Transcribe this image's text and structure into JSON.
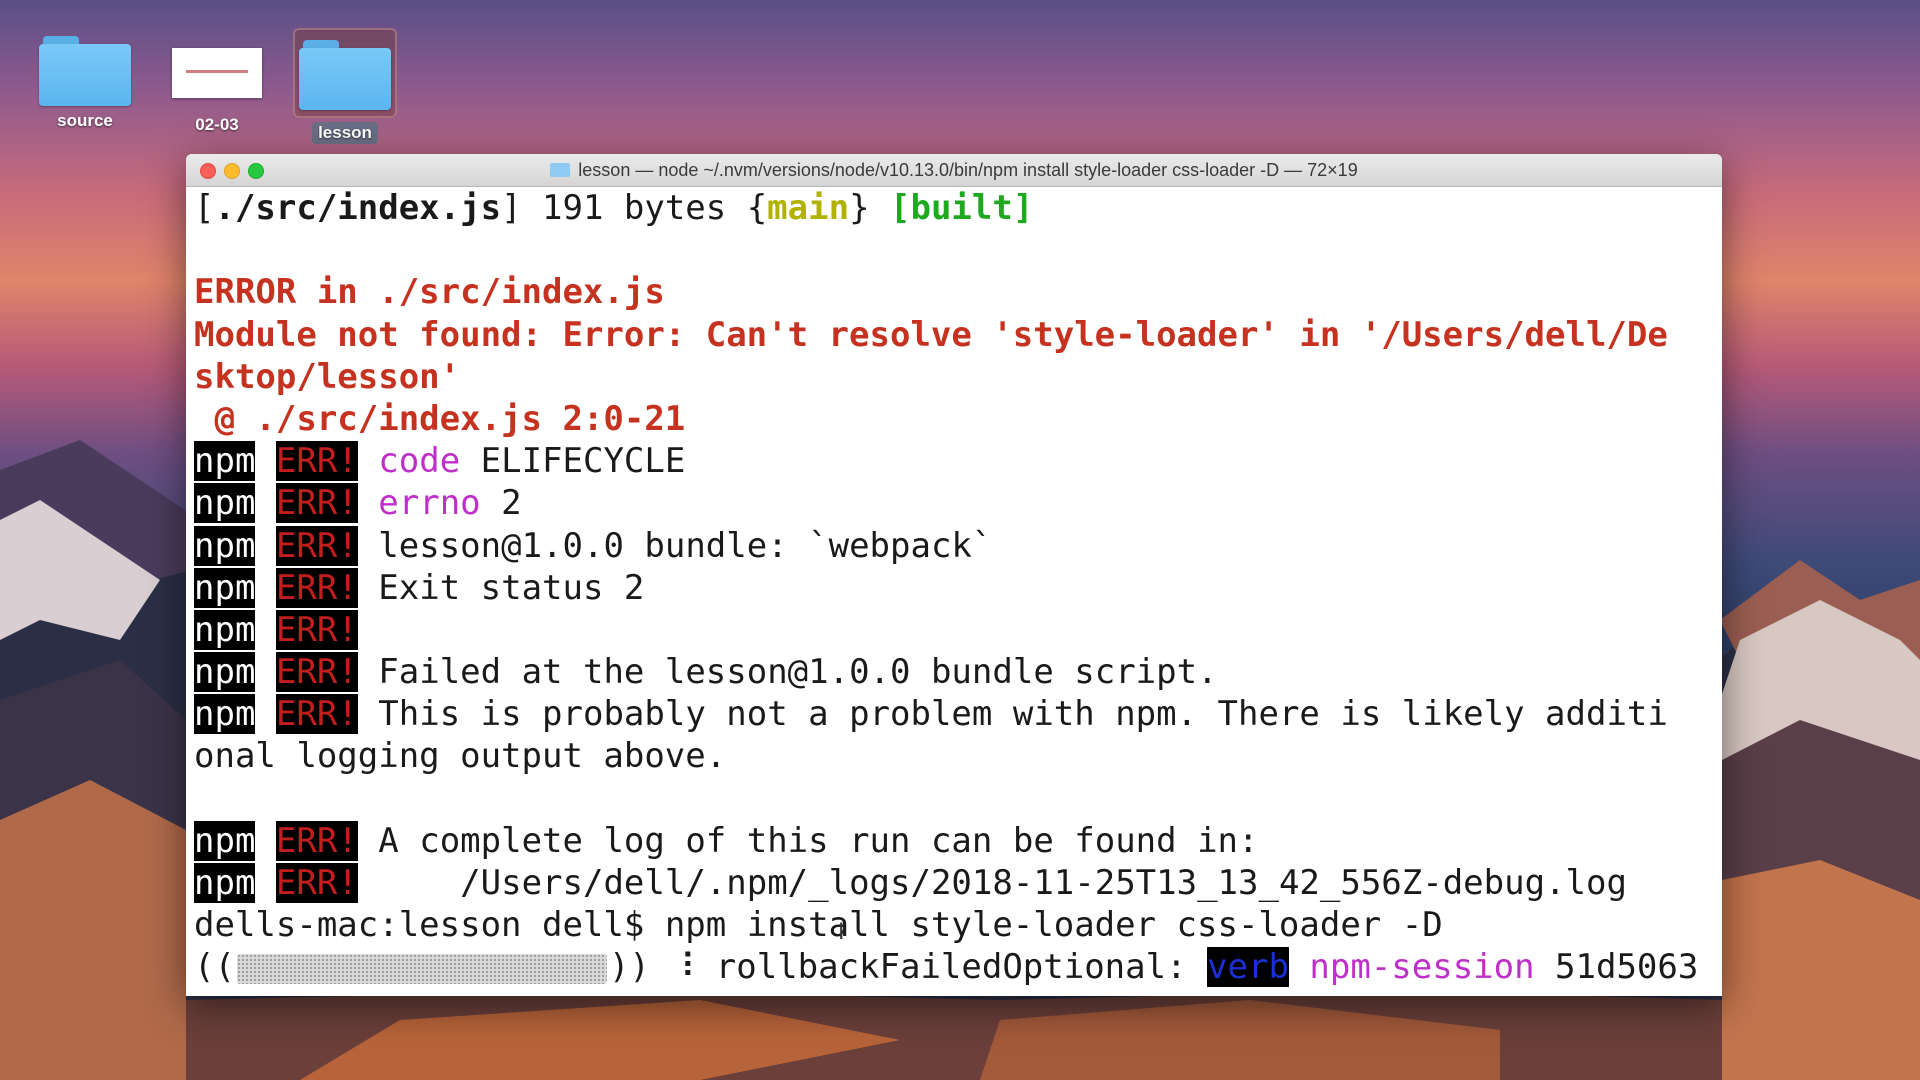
{
  "desktop": {
    "icons": [
      {
        "label": "source",
        "type": "folder"
      },
      {
        "label": "02-03",
        "type": "document"
      },
      {
        "label": "lesson",
        "type": "folder",
        "selected": true
      }
    ]
  },
  "terminal": {
    "title": "lesson — node ~/.nvm/versions/node/v10.13.0/bin/npm install style-loader css-loader -D — 72×19",
    "line1": {
      "p1": "[",
      "path": "./src/index.js",
      "p2": "] 191 bytes {",
      "main": "main",
      "p3": "} ",
      "built": "[built]"
    },
    "error_header": "ERROR in ./src/index.js",
    "error_msg_1": "Module not found: Error: Can't resolve 'style-loader' in '/Users/dell/De",
    "error_msg_2": "sktop/lesson'",
    "error_at": " @ ./src/index.js 2:0-21",
    "npm_label": "npm",
    "err_label": "ERR!",
    "npm_lines": [
      {
        "key": "code",
        "value": " ELIFECYCLE"
      },
      {
        "key": "errno",
        "value": " 2"
      },
      {
        "key": "",
        "value": "lesson@1.0.0 bundle: `webpack`"
      },
      {
        "key": "",
        "value": "Exit status 2"
      },
      {
        "key": "",
        "value": ""
      },
      {
        "key": "",
        "value": "Failed at the lesson@1.0.0 bundle script."
      },
      {
        "key": "",
        "value": "This is probably not a problem with npm. There is likely additi"
      }
    ],
    "wrap_line": "onal logging output above.",
    "log_line_1": "A complete log of this run can be found in:",
    "log_line_2": "    /Users/dell/.npm/_logs/2018-11-25T13_13_42_556Z-debug.log",
    "prompt": "dells-mac:lesson dell$ ",
    "command": "npm install style-loader css-loader -D",
    "progress": {
      "open": "((",
      "close": "))",
      "spinner": " ⠸ ",
      "status": "rollbackFailedOptional: ",
      "verb": "verb",
      "session_key": "npm-session",
      "session_id": " 51d5063"
    }
  }
}
